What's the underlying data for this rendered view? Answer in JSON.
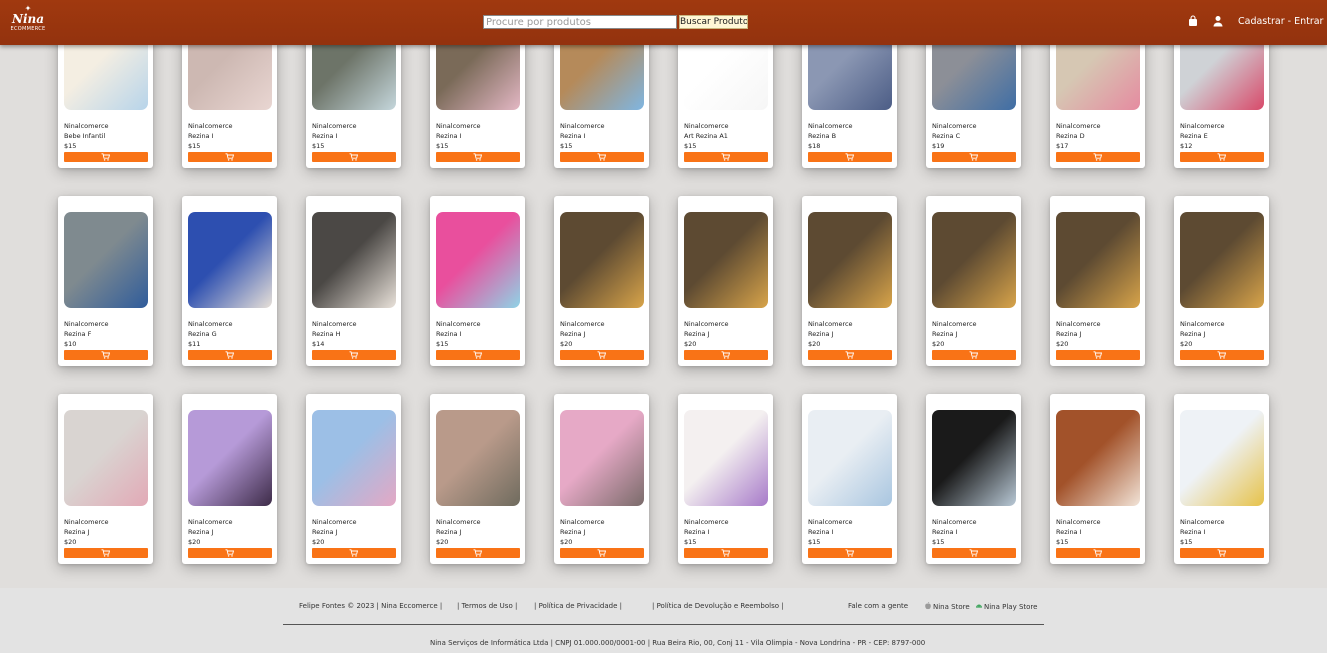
{
  "header": {
    "logo": {
      "star": "✦",
      "name": "Nina",
      "sub": "ECOMMERCE"
    },
    "search": {
      "placeholder": "Procure por produtos",
      "value": ""
    },
    "search_button": "Buscar Produto",
    "auth_links": "Cadastrar - Entrar",
    "icons": [
      "bag-icon",
      "user-icon"
    ]
  },
  "colors": {
    "header": "#9a3412",
    "cart_button": "#f97316",
    "background": "#e0dedc"
  },
  "products": [
    {
      "seller": "Ninalcomerce",
      "name": "Bebe Infantil",
      "price": "$15",
      "colors": [
        "#f4eee2",
        "#b7d4ea"
      ]
    },
    {
      "seller": "Ninalcomerce",
      "name": "Rezina I",
      "price": "$15",
      "colors": [
        "#cdb8b2",
        "#e9d6d2"
      ]
    },
    {
      "seller": "Ninalcomerce",
      "name": "Rezina I",
      "price": "$15",
      "colors": [
        "#6d7468",
        "#c5d7dc"
      ]
    },
    {
      "seller": "Ninalcomerce",
      "name": "Rezina I",
      "price": "$15",
      "colors": [
        "#7a6a58",
        "#e3b7c4"
      ]
    },
    {
      "seller": "Ninalcomerce",
      "name": "Rezina I",
      "price": "$15",
      "colors": [
        "#b58a5a",
        "#7fb6e2"
      ]
    },
    {
      "seller": "Ninalcomerce",
      "name": "Art Rezina A1",
      "price": "$15",
      "colors": [
        "#ffffff",
        "#f6f6f6"
      ]
    },
    {
      "seller": "Ninalcomerce",
      "name": "Rezina B",
      "price": "$18",
      "colors": [
        "#8b97b3",
        "#4c5d86"
      ]
    },
    {
      "seller": "Ninalcomerce",
      "name": "Rezina C",
      "price": "$19",
      "colors": [
        "#8c8f97",
        "#3f6ea5"
      ]
    },
    {
      "seller": "Ninalcomerce",
      "name": "Rezina D",
      "price": "$17",
      "colors": [
        "#d6c7b3",
        "#e58ba0"
      ]
    },
    {
      "seller": "Ninalcomerce",
      "name": "Rezina E",
      "price": "$12",
      "colors": [
        "#cfd2d6",
        "#d84a6a"
      ]
    },
    {
      "seller": "Ninalcomerce",
      "name": "Rezina F",
      "price": "$10",
      "colors": [
        "#7f8a8f",
        "#2f5c9b"
      ]
    },
    {
      "seller": "Ninalcomerce",
      "name": "Rezina G",
      "price": "$11",
      "colors": [
        "#2d4fb0",
        "#e7e0d8"
      ]
    },
    {
      "seller": "Ninalcomerce",
      "name": "Rezina H",
      "price": "$14",
      "colors": [
        "#4b4845",
        "#e9e2da"
      ]
    },
    {
      "seller": "Ninalcomerce",
      "name": "Rezina I",
      "price": "$15",
      "colors": [
        "#e94f9d",
        "#8fd3e6"
      ]
    },
    {
      "seller": "Ninalcomerce",
      "name": "Rezina J",
      "price": "$20",
      "colors": [
        "#5d4a32",
        "#d8a44a"
      ]
    },
    {
      "seller": "Ninalcomerce",
      "name": "Rezina J",
      "price": "$20",
      "colors": [
        "#5d4a32",
        "#d8a44a"
      ]
    },
    {
      "seller": "Ninalcomerce",
      "name": "Rezina J",
      "price": "$20",
      "colors": [
        "#5d4a32",
        "#d8a44a"
      ]
    },
    {
      "seller": "Ninalcomerce",
      "name": "Rezina J",
      "price": "$20",
      "colors": [
        "#5d4a32",
        "#d8a44a"
      ]
    },
    {
      "seller": "Ninalcomerce",
      "name": "Rezina J",
      "price": "$20",
      "colors": [
        "#5d4a32",
        "#d8a44a"
      ]
    },
    {
      "seller": "Ninalcomerce",
      "name": "Rezina J",
      "price": "$20",
      "colors": [
        "#5d4a32",
        "#d8a44a"
      ]
    },
    {
      "seller": "Ninalcomerce",
      "name": "Rezina J",
      "price": "$20",
      "colors": [
        "#d9d4d1",
        "#e2a9b6"
      ]
    },
    {
      "seller": "Ninalcomerce",
      "name": "Rezina J",
      "price": "$20",
      "colors": [
        "#b69ad8",
        "#3d2b48"
      ]
    },
    {
      "seller": "Ninalcomerce",
      "name": "Rezina J",
      "price": "$20",
      "colors": [
        "#9cbfe6",
        "#e4a8c4"
      ]
    },
    {
      "seller": "Ninalcomerce",
      "name": "Rezina J",
      "price": "$20",
      "colors": [
        "#b99a8a",
        "#6f6b5e"
      ]
    },
    {
      "seller": "Ninalcomerce",
      "name": "Rezina J",
      "price": "$20",
      "colors": [
        "#e6a9c6",
        "#7a6b6a"
      ]
    },
    {
      "seller": "Ninalcomerce",
      "name": "Rezina I",
      "price": "$15",
      "colors": [
        "#f4f0f0",
        "#a77ac9"
      ]
    },
    {
      "seller": "Ninalcomerce",
      "name": "Rezina I",
      "price": "$15",
      "colors": [
        "#e9eef3",
        "#a9c6e0"
      ]
    },
    {
      "seller": "Ninalcomerce",
      "name": "Rezina I",
      "price": "$15",
      "colors": [
        "#1a1a1a",
        "#b9c9d6"
      ]
    },
    {
      "seller": "Ninalcomerce",
      "name": "Rezina I",
      "price": "$15",
      "colors": [
        "#a2522a",
        "#f2e4d8"
      ]
    },
    {
      "seller": "Ninalcomerce",
      "name": "Rezina I",
      "price": "$15",
      "colors": [
        "#eef2f6",
        "#e6c24a"
      ]
    }
  ],
  "footer": {
    "copyright": "Felipe Fontes © 2023 | Nina Eccomerce |",
    "terms": "| Termos de Uso |",
    "privacy": "| Política de Privacidade |",
    "returns": "| Política de Devolução e Reembolso |",
    "contact": "Fale com a gente",
    "apple_store": "Nina Store",
    "play_store": "Nina Play Store",
    "company": "Nina Serviços de Informática Ltda | CNPJ 01.000.000/0001-00 | Rua Beira Rio, 00, Conj 11 - Vila Olimpia - Nova Londrina - PR - CEP: 8797-000"
  }
}
